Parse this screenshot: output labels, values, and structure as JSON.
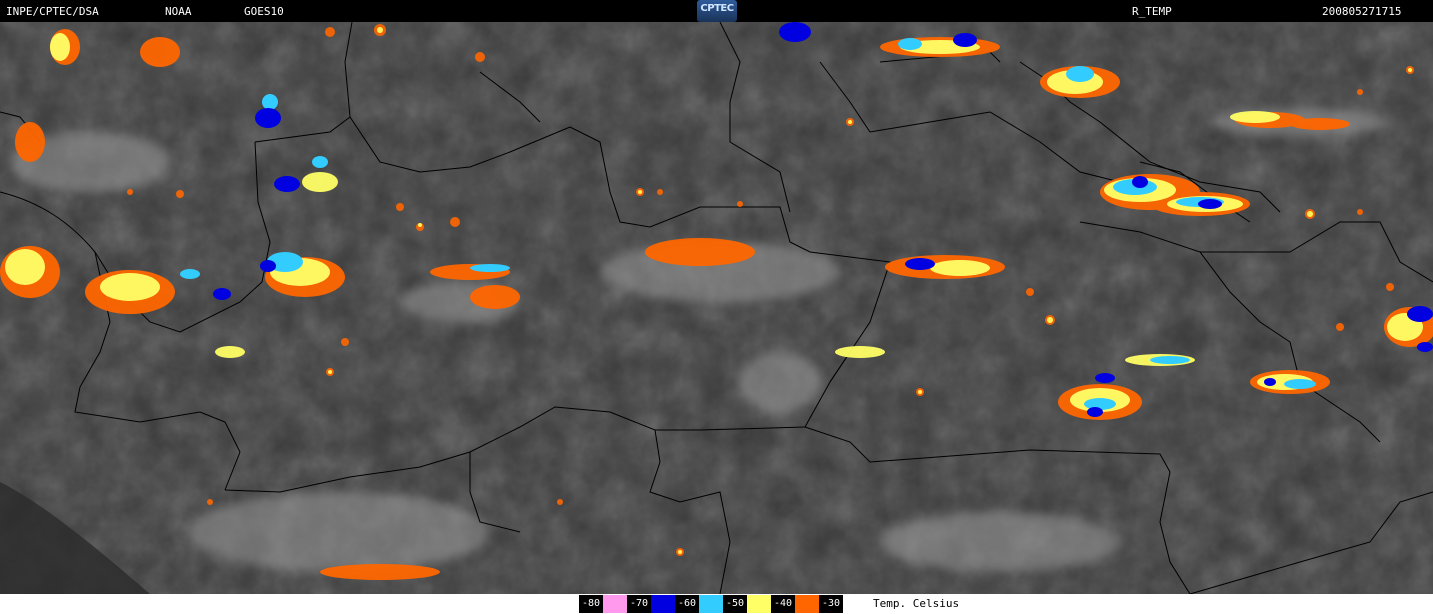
{
  "header": {
    "organization": "INPE/CPTEC/DSA",
    "agency": "NOAA",
    "satellite": "GOES10",
    "logo_text": "CPTEC",
    "product": "R_TEMP",
    "timestamp": "200805271715"
  },
  "legend": {
    "unit_label": "Temp. Celsius",
    "entries": [
      {
        "value": "-80",
        "color": "#ff99ee"
      },
      {
        "value": "-70",
        "color": "#0000e0"
      },
      {
        "value": "-60",
        "color": "#33ccff"
      },
      {
        "value": "-50",
        "color": "#ffff66"
      },
      {
        "value": "-40",
        "color": "#ff6600"
      },
      {
        "value": "-30",
        "color": "#ffffff"
      }
    ]
  }
}
